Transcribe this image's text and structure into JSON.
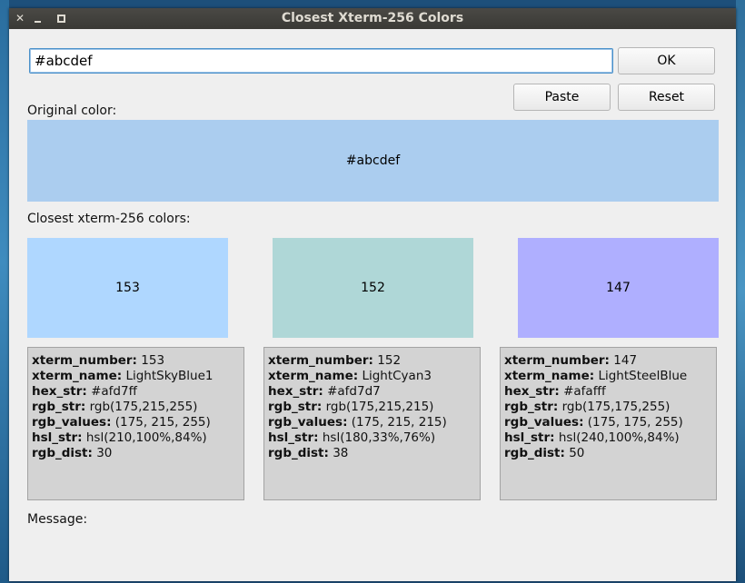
{
  "window": {
    "title": "Closest Xterm-256 Colors",
    "close_glyph": "✕"
  },
  "input": {
    "value": "#abcdef"
  },
  "buttons": {
    "ok": "OK",
    "paste": "Paste",
    "reset": "Reset"
  },
  "labels": {
    "original": "Original color:",
    "closest": "Closest xterm-256 colors:",
    "message": "Message:"
  },
  "original": {
    "hex": "#abcdef",
    "color": "#abcdef"
  },
  "keys": {
    "xterm_number": "xterm_number:",
    "xterm_name": "xterm_name:",
    "hex_str": "hex_str:",
    "rgb_str": "rgb_str:",
    "rgb_values": "rgb_values:",
    "hsl_str": "hsl_str:",
    "rgb_dist": "rgb_dist:"
  },
  "matches": [
    {
      "swatch_label": "153",
      "color": "#afd7ff",
      "xterm_number": "153",
      "xterm_name": "LightSkyBlue1",
      "hex_str": "#afd7ff",
      "rgb_str": "rgb(175,215,255)",
      "rgb_values": "(175, 215, 255)",
      "hsl_str": "hsl(210,100%,84%)",
      "rgb_dist": "30"
    },
    {
      "swatch_label": "152",
      "color": "#afd7d7",
      "xterm_number": "152",
      "xterm_name": "LightCyan3",
      "hex_str": "#afd7d7",
      "rgb_str": "rgb(175,215,215)",
      "rgb_values": "(175, 215, 215)",
      "hsl_str": "hsl(180,33%,76%)",
      "rgb_dist": "38"
    },
    {
      "swatch_label": "147",
      "color": "#afafff",
      "xterm_number": "147",
      "xterm_name": "LightSteelBlue",
      "hex_str": "#afafff",
      "rgb_str": "rgb(175,175,255)",
      "rgb_values": "(175, 175, 255)",
      "hsl_str": "hsl(240,100%,84%)",
      "rgb_dist": "50"
    }
  ]
}
